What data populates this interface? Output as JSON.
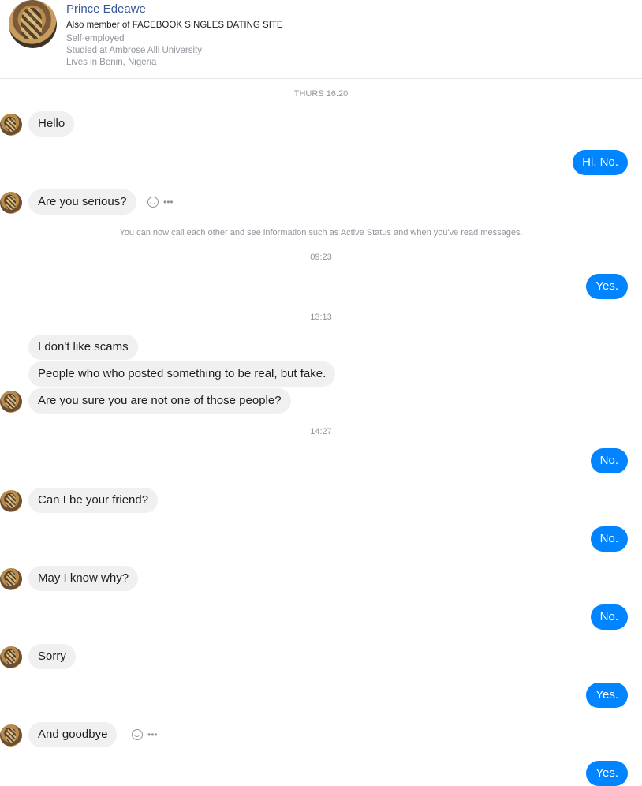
{
  "header": {
    "name": "Prince Edeawe",
    "subtitle": "Also member of FACEBOOK SINGLES DATING SITE",
    "details": [
      "Self-employed",
      "Studied at Ambrose Alli University",
      "Lives in Benin, Nigeria"
    ]
  },
  "messages": {
    "m1": "Hello",
    "m2": "Hi. No.",
    "m3": "Are you serious?",
    "m4": "Yes.",
    "m5": "I don't like scams",
    "m6": "People who who posted something to be real, but fake.",
    "m7": "Are you sure you are not one of those people?",
    "m8": "No.",
    "m9": "Can I be your friend?",
    "m10": "No.",
    "m11": "May I know why?",
    "m12": "No.",
    "m13": "Sorry",
    "m14": "Yes.",
    "m15": "And goodbye",
    "m16": "Yes."
  },
  "timestamps": {
    "t1": "THURS 16:20",
    "t2": "09:23",
    "t3": "13:13",
    "t4": "14:27"
  },
  "notice": "You can now call each other and see information such as Active Status and when you've read messages.",
  "icons": {
    "react": "smiley-reaction-icon",
    "more": "more-options-icon"
  }
}
